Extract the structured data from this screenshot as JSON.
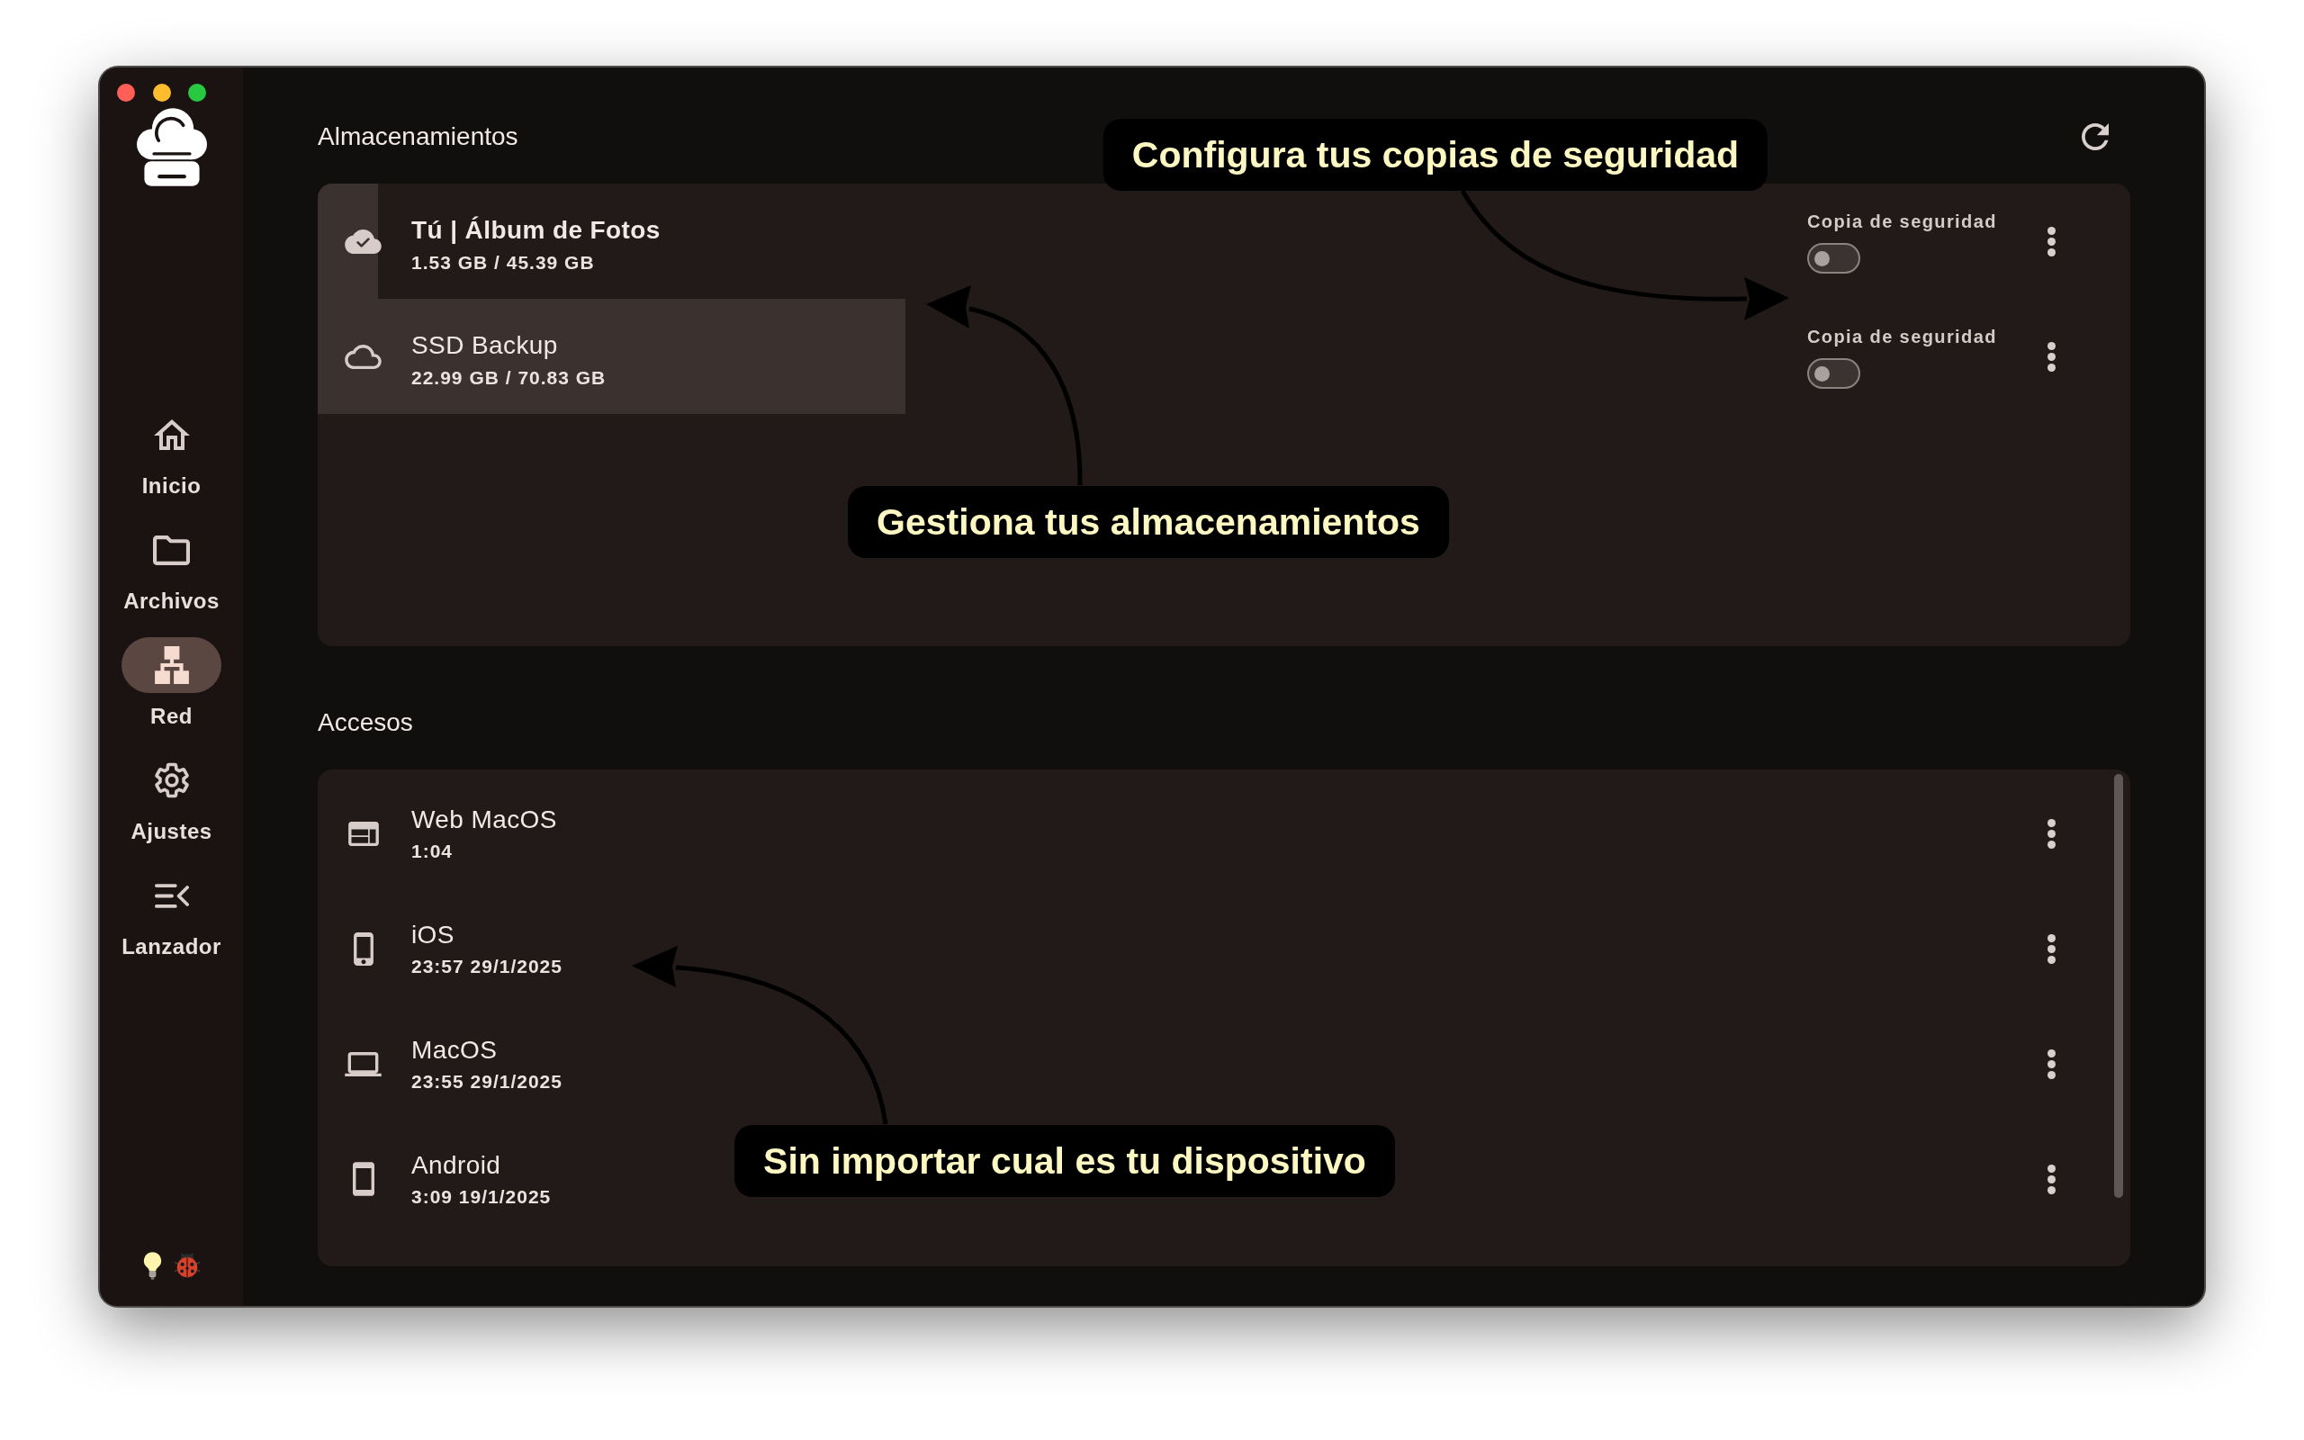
{
  "sidebar": {
    "items": [
      {
        "label": "Inicio",
        "selected": false
      },
      {
        "label": "Archivos",
        "selected": false
      },
      {
        "label": "Red",
        "selected": true
      },
      {
        "label": "Ajustes",
        "selected": false
      },
      {
        "label": "Lanzador",
        "selected": false
      }
    ]
  },
  "storages": {
    "title": "Almacenamientos",
    "items": [
      {
        "name": "Tú | Álbum de Fotos",
        "usage": "1.53 GB / 45.39 GB",
        "active": true,
        "selected": false,
        "highlighted": true,
        "backup_label": "Copia de seguridad",
        "backup": false
      },
      {
        "name": "SSD Backup",
        "usage": "22.99 GB / 70.83 GB",
        "active": false,
        "selected": true,
        "highlighted": false,
        "backup_label": "Copia de seguridad",
        "backup": false
      }
    ]
  },
  "accesses": {
    "title": "Accesos",
    "items": [
      {
        "name": "Web MacOS",
        "last_seen": "1:04"
      },
      {
        "name": "iOS",
        "last_seen": "23:57 29/1/2025"
      },
      {
        "name": "MacOS",
        "last_seen": "23:55 29/1/2025"
      },
      {
        "name": "Android",
        "last_seen": "3:09 19/1/2025"
      }
    ]
  },
  "annotations": [
    "Configura tus copias de seguridad",
    "Gestiona tus almacenamientos",
    "Sin importar cual es tu dispositivo"
  ]
}
